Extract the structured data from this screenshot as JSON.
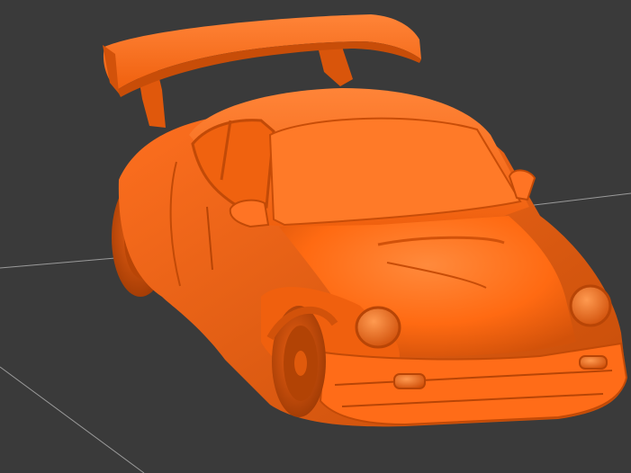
{
  "viewport": {
    "background": "#3a3a3a",
    "grid_line_color": "#9a9a9a"
  },
  "model": {
    "subject": "car-3d-model",
    "material_color": "#ff6a12",
    "shade_dark": "#d2520a",
    "shade_deep": "#a63e05",
    "highlight": "#ff8a3c"
  }
}
